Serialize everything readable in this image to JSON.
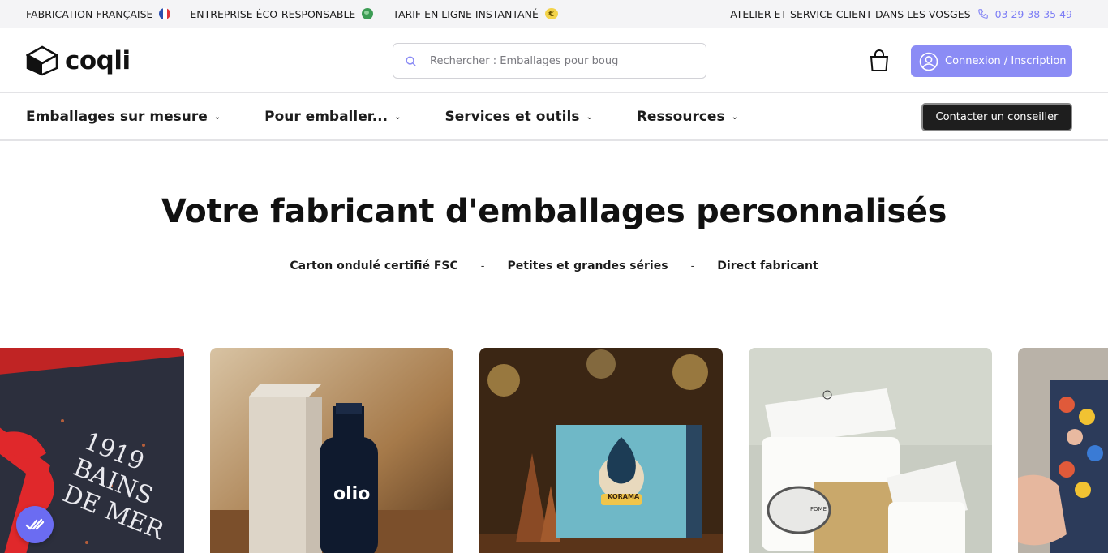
{
  "topbar": {
    "items": [
      {
        "label": "FABRICATION FRANÇAISE",
        "icon": "france-flag-icon"
      },
      {
        "label": "ENTREPRISE ÉCO-RESPONSABLE",
        "icon": "globe-icon"
      },
      {
        "label": "TARIF EN LIGNE INSTANTANÉ",
        "icon": "euro-icon"
      }
    ],
    "contact_label": "ATELIER ET SERVICE CLIENT DANS LES VOSGES",
    "phone": "03 29 38 35 49"
  },
  "header": {
    "logo_text": "coqli",
    "search_placeholder": "Rechercher : Emballages pour boug",
    "login_label": "Connexion / Inscription"
  },
  "nav": {
    "items": [
      {
        "label": "Emballages sur mesure"
      },
      {
        "label": "Pour emballer..."
      },
      {
        "label": "Services et outils"
      },
      {
        "label": "Ressources"
      }
    ],
    "contact_button": "Contacter un conseiller"
  },
  "hero": {
    "title": "Votre fabricant d'emballages personnalisés",
    "tags": [
      "Carton ondulé certifié FSC",
      "Petites et grandes séries",
      "Direct fabricant"
    ],
    "separator": "-"
  },
  "gallery": {
    "images": [
      {
        "name": "bains-de-mer-gift-box",
        "text": "1919 BAINS DE MER"
      },
      {
        "name": "olio-bottle-box",
        "text": "olio"
      },
      {
        "name": "korama-holiday-box",
        "text": "KORAMA"
      },
      {
        "name": "fome-white-mailer-box",
        "text": "FOME"
      },
      {
        "name": "illustrated-box-partial",
        "text": ""
      }
    ]
  },
  "colors": {
    "accent": "#8b8cf5",
    "highlight": "#bfeccc",
    "dark_button": "#1e1e1e"
  }
}
